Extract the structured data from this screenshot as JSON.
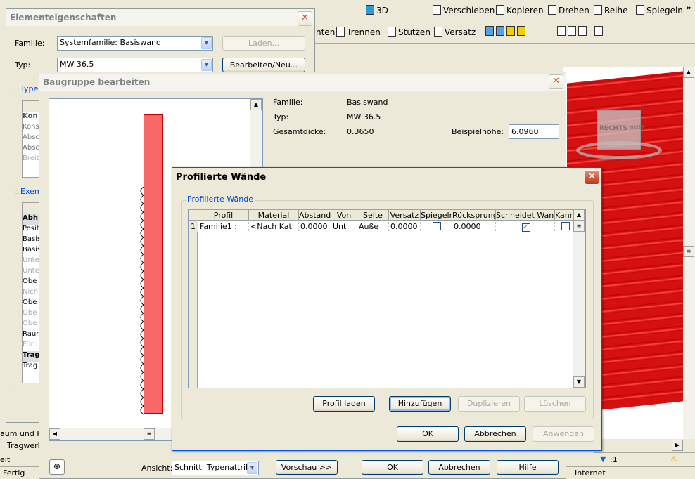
{
  "toolbar": {
    "row1": [
      "Verschieben",
      "Kopieren",
      "Drehen",
      "Reihe",
      "Spiegeln"
    ],
    "row1_left": "3D",
    "row2": [
      "nten",
      "Trennen",
      "Stutzen",
      "Versatz"
    ],
    "more": "»"
  },
  "bg_left": {
    "labels": [
      "aum und Fla",
      "Tragwerk",
      "eit",
      "Fertig"
    ]
  },
  "status": {
    "filter": ":1",
    "internet": "Internet"
  },
  "viewcube": {
    "label": "RECHTS",
    "label2": "HINTEN"
  },
  "elem_dlg": {
    "title": "Elementeigenschaften",
    "familie_label": "Familie:",
    "familie_value": "Systemfamilie: Basiswand",
    "laden": "Laden...",
    "typ_label": "Typ:",
    "typ_value": "MW 36.5",
    "bearbeiten": "Bearbeiten/Neu...",
    "type_group": "Type",
    "type_rows": [
      "Kon",
      "Kons",
      "Absc",
      "Absc",
      "Breit"
    ],
    "exem_group": "Exem",
    "exem_rows": [
      "Abh",
      "Posit",
      "Basis",
      "Basis",
      "Unte",
      "Unte",
      "Obe",
      "Nich",
      "Obe",
      "Obe",
      "Obe",
      "Raum",
      "Für I",
      "Trag",
      "Trag"
    ]
  },
  "bg_dlg": {
    "title": "Baugruppe bearbeiten",
    "familie_label": "Familie:",
    "familie_value": "Basiswand",
    "typ_label": "Typ:",
    "typ_value": "MW 36.5",
    "dicke_label": "Gesamtdicke:",
    "dicke_value": "0.3650",
    "hoehe_label": "Beispielhöhe:",
    "hoehe_value": "6.0960",
    "ansicht_label": "Ansicht:",
    "ansicht_value": "Schnitt: Typenattribu",
    "vorschau": "Vorschau >>",
    "ok": "OK",
    "abbrechen": "Abbrechen",
    "hilfe": "Hilfe"
  },
  "pw_dlg": {
    "title": "Profilierte Wände",
    "group": "Profilierte Wände",
    "columns": [
      "Profil",
      "Material",
      "Abstand",
      "Von",
      "Seite",
      "Versatz",
      "Spiegeln",
      "Rücksprung",
      "Schneidet Wand",
      "Kann"
    ],
    "rows": [
      {
        "num": "1",
        "profil": "Familie1 :",
        "material": "<Nach Kat",
        "abstand": "0.0000",
        "von": "Unt",
        "seite": "Auße",
        "versatz": "0.0000",
        "spiegeln": false,
        "ruecksprung": "0.0000",
        "schneidet": true,
        "kann": false
      }
    ],
    "profil_laden": "Profil laden",
    "hinzufuegen": "Hinzufügen",
    "duplizieren": "Duplizieren",
    "loeschen": "Löschen",
    "ok": "OK",
    "abbrechen": "Abbrechen",
    "anwenden": "Anwenden"
  }
}
